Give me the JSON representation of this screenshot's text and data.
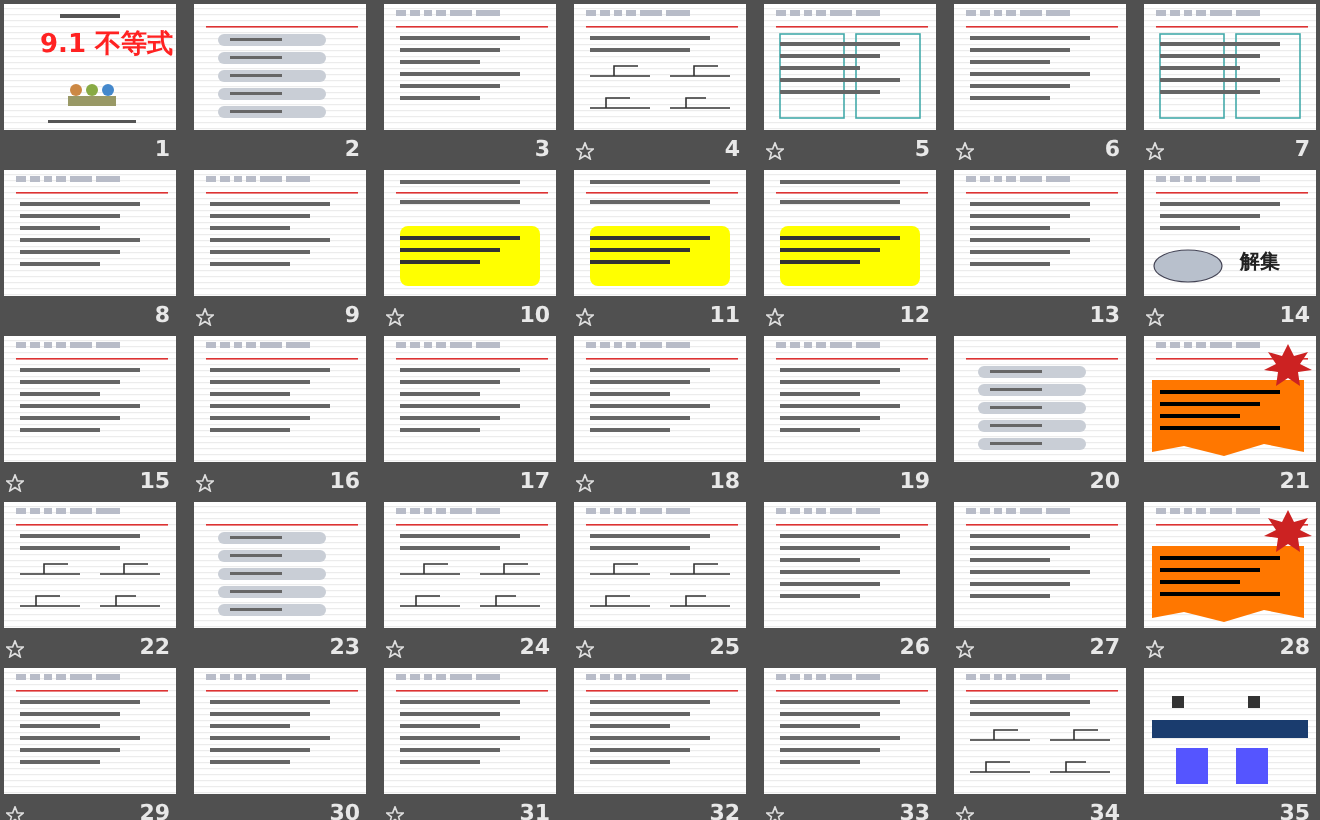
{
  "slides": [
    {
      "number": "1",
      "kind": "title",
      "title": "9.1 不等式",
      "animated": false
    },
    {
      "number": "2",
      "kind": "menu",
      "animated": false
    },
    {
      "number": "3",
      "kind": "content",
      "animated": false
    },
    {
      "number": "4",
      "kind": "lines",
      "animated": true
    },
    {
      "number": "5",
      "kind": "boxes",
      "animated": true
    },
    {
      "number": "6",
      "kind": "content",
      "animated": true
    },
    {
      "number": "7",
      "kind": "boxes",
      "animated": true
    },
    {
      "number": "8",
      "kind": "content",
      "animated": false
    },
    {
      "number": "9",
      "kind": "content",
      "animated": true
    },
    {
      "number": "10",
      "kind": "yellow",
      "animated": true
    },
    {
      "number": "11",
      "kind": "yellow",
      "animated": true
    },
    {
      "number": "12",
      "kind": "yellow",
      "animated": true
    },
    {
      "number": "13",
      "kind": "content",
      "animated": false
    },
    {
      "number": "14",
      "kind": "oval",
      "title": "解集",
      "animated": true
    },
    {
      "number": "15",
      "kind": "content",
      "animated": true
    },
    {
      "number": "16",
      "kind": "content",
      "animated": true
    },
    {
      "number": "17",
      "kind": "content",
      "animated": false
    },
    {
      "number": "18",
      "kind": "content",
      "animated": true
    },
    {
      "number": "19",
      "kind": "content",
      "animated": false
    },
    {
      "number": "20",
      "kind": "menu",
      "animated": false
    },
    {
      "number": "21",
      "kind": "orange",
      "animated": false
    },
    {
      "number": "22",
      "kind": "lines",
      "animated": true
    },
    {
      "number": "23",
      "kind": "menu",
      "animated": false
    },
    {
      "number": "24",
      "kind": "lines",
      "animated": true
    },
    {
      "number": "25",
      "kind": "lines",
      "animated": true
    },
    {
      "number": "26",
      "kind": "content",
      "animated": false
    },
    {
      "number": "27",
      "kind": "content",
      "animated": true
    },
    {
      "number": "28",
      "kind": "orange",
      "animated": true
    },
    {
      "number": "29",
      "kind": "content",
      "animated": true
    },
    {
      "number": "30",
      "kind": "content",
      "animated": false
    },
    {
      "number": "31",
      "kind": "content",
      "animated": true
    },
    {
      "number": "32",
      "kind": "content",
      "animated": false
    },
    {
      "number": "33",
      "kind": "content",
      "animated": true
    },
    {
      "number": "34",
      "kind": "lines",
      "animated": true
    },
    {
      "number": "35",
      "kind": "end",
      "animated": false
    }
  ]
}
